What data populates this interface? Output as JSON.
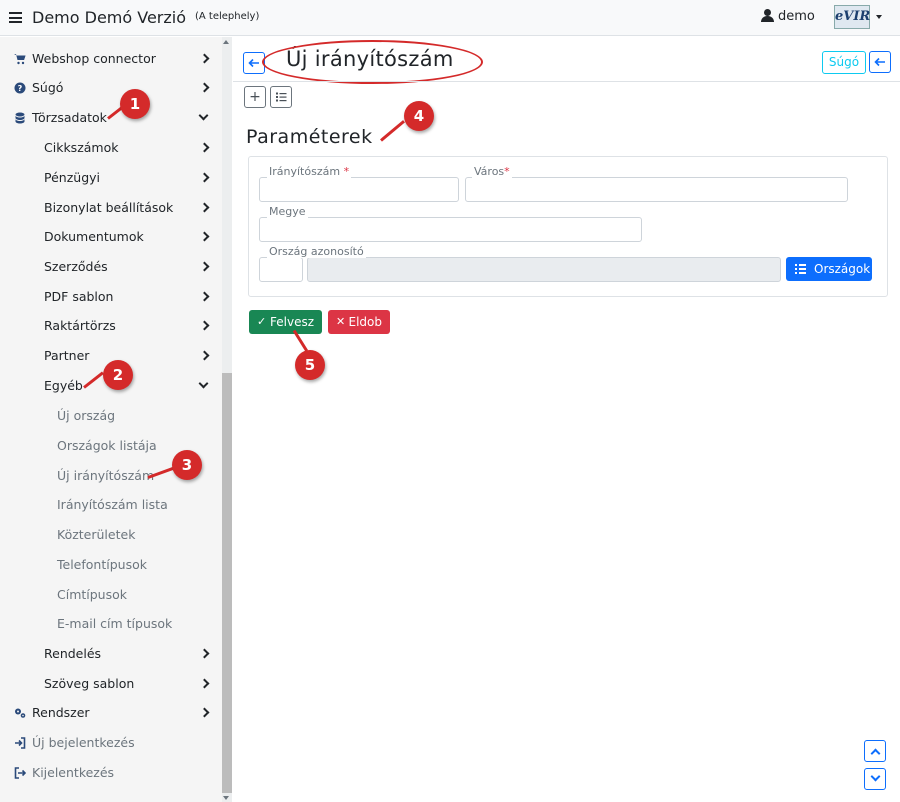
{
  "topbar": {
    "title": "Demo Demó Verzió",
    "subtitle": "(A telephely)",
    "user": "demo",
    "logo_text": "eVIR"
  },
  "sidebar": {
    "items": [
      {
        "label": "Webshop connector",
        "icon": "cart-icon"
      },
      {
        "label": "Súgó",
        "icon": "question-circle-icon"
      },
      {
        "label": "Törzsadatok",
        "icon": "database-icon"
      },
      {
        "label": "Cikkszámok"
      },
      {
        "label": "Pénzügyi"
      },
      {
        "label": "Bizonylat beállítások"
      },
      {
        "label": "Dokumentumok"
      },
      {
        "label": "Szerződés"
      },
      {
        "label": "PDF sablon"
      },
      {
        "label": "Raktártörzs"
      },
      {
        "label": "Partner"
      },
      {
        "label": "Egyéb"
      },
      {
        "label": "Új ország"
      },
      {
        "label": "Országok listája"
      },
      {
        "label": "Új irányítószám"
      },
      {
        "label": "Irányítószám lista"
      },
      {
        "label": "Közterületek"
      },
      {
        "label": "Telefontípusok"
      },
      {
        "label": "Címtípusok"
      },
      {
        "label": "E-mail cím típusok"
      },
      {
        "label": "Rendelés"
      },
      {
        "label": "Szöveg sablon"
      },
      {
        "label": "Rendszer",
        "icon": "gears-icon"
      },
      {
        "label": "Új bejelentkezés",
        "icon": "sign-in-icon"
      },
      {
        "label": "Kijelentkezés",
        "icon": "sign-out-icon"
      }
    ]
  },
  "main": {
    "page_title": "Új irányítószám",
    "help_label": "Súgó",
    "add_icon": "+",
    "section_title": "Paraméterek",
    "form": {
      "zip_label": "Irányítószám",
      "city_label": "Város",
      "county_label": "Megye",
      "country_label": "Ország azonosító",
      "required_mark": "*",
      "countries_button": "Országok"
    },
    "save_label": "Felvesz",
    "discard_label": "Eldob"
  },
  "markers": [
    "1",
    "2",
    "3",
    "4",
    "5"
  ],
  "colors": {
    "primary": "#0d6efd",
    "success": "#198754",
    "danger": "#dc3545",
    "marker": "#d42a2a",
    "info": "#0dcaf0"
  }
}
